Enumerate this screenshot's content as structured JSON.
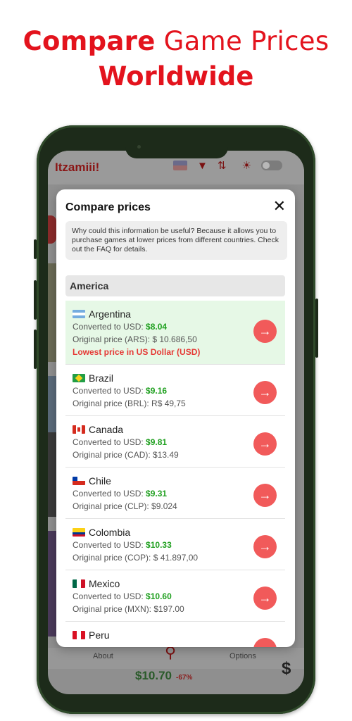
{
  "headline": {
    "bold": "Compare",
    "rest": " Game Prices",
    "line2": "Worldwide"
  },
  "app": {
    "title": "Itzamiii!",
    "icons": [
      "us-flag-icon",
      "filter-icon",
      "sort-icon",
      "sun-icon",
      "theme-toggle"
    ],
    "bottom_nav": {
      "about": "About",
      "options": "Options"
    },
    "peek_price": "$10.70",
    "peek_discount": "-67%",
    "peek_symbol": "$"
  },
  "modal": {
    "title": "Compare prices",
    "close": "✕",
    "info": "Why could this information be useful? Because it allows you to purchase games at lower prices from different countries. Check out the FAQ for details.",
    "region": "America",
    "converted_label": "Converted to USD: ",
    "original_label": "Original price",
    "lowest_note": "Lowest price in US Dollar (USD)",
    "countries": [
      {
        "name": "Argentina",
        "flag": "argentina-flag-icon",
        "usd": "$8.04",
        "original": "Original price (ARS): $ 10.686,50",
        "lowest": true
      },
      {
        "name": "Brazil",
        "flag": "brazil-flag-icon",
        "usd": "$9.16",
        "original": "Original price (BRL): R$ 49,75"
      },
      {
        "name": "Canada",
        "flag": "canada-flag-icon",
        "usd": "$9.81",
        "original": "Original price (CAD): $13.49"
      },
      {
        "name": "Chile",
        "flag": "chile-flag-icon",
        "usd": "$9.31",
        "original": "Original price (CLP): $9.024"
      },
      {
        "name": "Colombia",
        "flag": "colombia-flag-icon",
        "usd": "$10.33",
        "original": "Original price (COP): $ 41.897,00"
      },
      {
        "name": "Mexico",
        "flag": "mexico-flag-icon",
        "usd": "$10.60",
        "original": "Original price (MXN): $197.00"
      },
      {
        "name": "Peru",
        "flag": "peru-flag-icon"
      }
    ]
  },
  "colors": {
    "accent": "#e3131d",
    "go_button": "#f15a5a",
    "price_green": "#20a020",
    "lowest_bg": "#e6f8e6"
  }
}
